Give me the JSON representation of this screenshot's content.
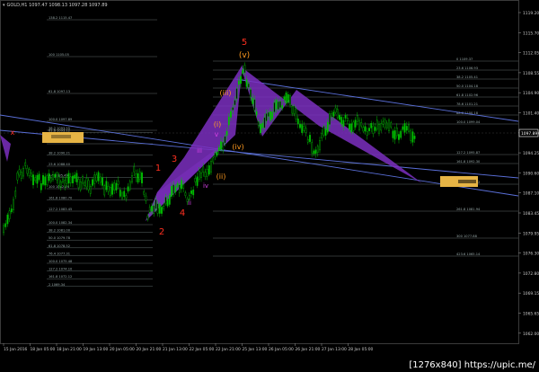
{
  "window": {
    "menu_arrow": "▾",
    "title": "GOLD,H1  1097.47  1098.13  1097.28  1097.89"
  },
  "price_axis": {
    "ticks": [
      "1119.20",
      "1115.70",
      "1112.05",
      "1108.55",
      "1104.90",
      "1101.40",
      "1097.89",
      "1094.25",
      "1090.60",
      "1087.10",
      "1083.45",
      "1079.95",
      "1076.30",
      "1072.80",
      "1069.15",
      "1065.65",
      "1062.00"
    ],
    "current_price": "1097.89"
  },
  "time_axis": {
    "ticks": [
      "15 Jan 2016",
      "18 Jan 05:00",
      "18 Jan 21:00",
      "19 Jan 13:00",
      "20 Jan 05:00",
      "20 Jan 21:00",
      "21 Jan 13:00",
      "22 Jan 05:00",
      "22 Jan 21:00",
      "25 Jan 13:00",
      "26 Jan 05:00",
      "26 Jan 21:00",
      "27 Jan 13:00",
      "28 Jan 05:00"
    ]
  },
  "wave_labels": {
    "major_5": "5",
    "sub_v": "(v)",
    "sub_iii": "(iii)",
    "sub_i": "(i)",
    "sub_iv": "(iv)",
    "sub_ii": "(ii)",
    "minor_v": "v",
    "minor_iii": "iii",
    "minor_iv": "iv",
    "minor_ii": "ii",
    "major_1": "1",
    "major_2": "2",
    "major_3": "3",
    "major_4": "4",
    "x_mark": "x"
  },
  "fib_left": [
    "100.0 1097.89",
    "61.8 1093.12",
    "50.0 1091.66",
    "38.2 1090.21",
    "23.6 1088.40",
    "0.0 1085.49",
    "100 1082.24",
    "161.8 1080.70",
    "127.2 1083.45"
  ],
  "fib_upper": [
    "138.2 1115.47",
    "100 1105.05",
    "61.8 1097.13",
    "38.2 1093.55"
  ],
  "fib_lower_left": [
    "100.0 1082.34",
    "38.2 1081.00",
    "50.0 1079.78",
    "61.8 1078.52",
    "76.4 1077.31",
    "100.0 1075.48",
    "127.2 1074.10",
    "161.8 1072.12",
    "2 1069.34"
  ],
  "fib_right": [
    "0 1109.37",
    "23.6 1106.93",
    "38.2 1105.41",
    "50.0 1104.18",
    "61.8 1102.96",
    "78.6 1101.21",
    "88.6 1100.18",
    "100.0 1099.04",
    "127.2 1095.87",
    "161.8 1092.30",
    "200.0 1088.32",
    "261.8 1081.94",
    "300 1077.88",
    "423.6 1065.14"
  ],
  "colors": {
    "background": "#000000",
    "bull_candle": "#00c000",
    "bear_candle": "#00c000",
    "pattern_fill": "#7b2fbf",
    "trendline": "#5a6fd8",
    "fib_line": "#5e6a6a",
    "box_fill": "#e6b445",
    "wave_red": "#ff3020",
    "wave_orange": "#ff9a20",
    "wave_magenta": "#d040e0",
    "axis_text": "#c8c8c8",
    "price_tag": "#ffffff"
  },
  "watermark": "[1276x840] https://upic.me/"
}
